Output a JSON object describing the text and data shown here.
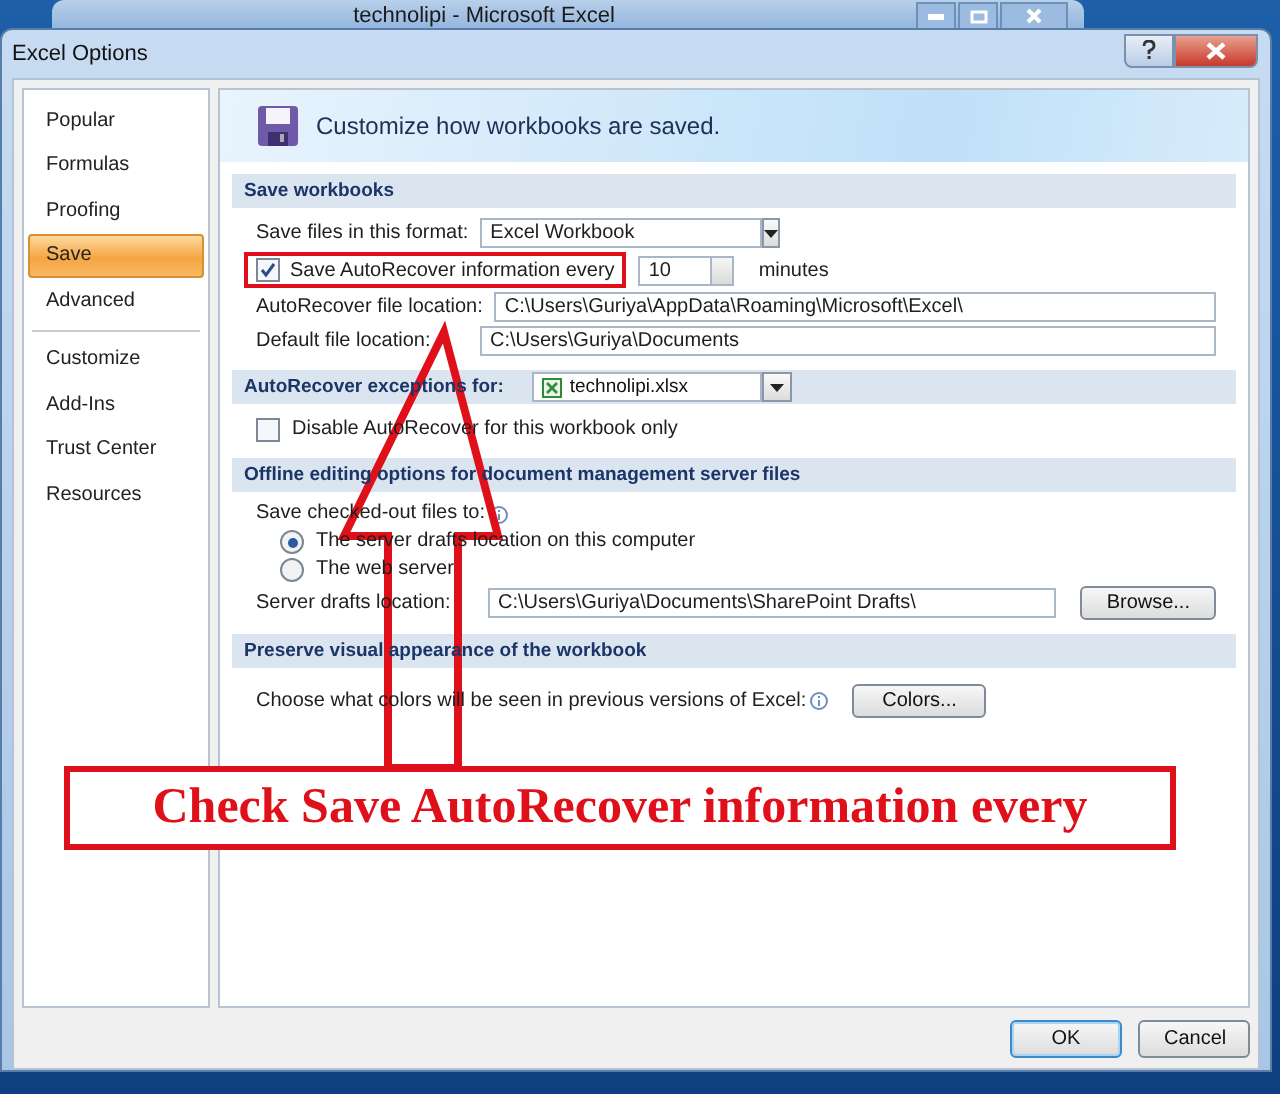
{
  "excel_window": {
    "title": "technolipi - Microsoft Excel"
  },
  "dialog": {
    "title": "Excel Options"
  },
  "sidebar": {
    "groups": [
      [
        {
          "label": "Popular",
          "selected": false
        },
        {
          "label": "Formulas",
          "selected": false
        },
        {
          "label": "Proofing",
          "selected": false
        },
        {
          "label": "Save",
          "selected": true
        },
        {
          "label": "Advanced",
          "selected": false
        }
      ],
      [
        {
          "label": "Customize",
          "selected": false
        },
        {
          "label": "Add-Ins",
          "selected": false
        },
        {
          "label": "Trust Center",
          "selected": false
        },
        {
          "label": "Resources",
          "selected": false
        }
      ]
    ]
  },
  "header": {
    "text": "Customize how workbooks are saved."
  },
  "sections": [
    {
      "title": "Save workbooks",
      "rows": [
        {
          "kind": "dropdown",
          "label": "Save files in this format:",
          "value": "Excel Workbook"
        },
        {
          "kind": "checkbox-spin",
          "label": "Save AutoRecover information every",
          "checked": true,
          "highlighted": true,
          "value": "10",
          "unit": "minutes"
        },
        {
          "kind": "path",
          "label": "AutoRecover file location:",
          "value": "C:\\Users\\Guriya\\AppData\\Roaming\\Microsoft\\Excel\\"
        },
        {
          "kind": "path",
          "label": "Default file location:",
          "value": "C:\\Users\\Guriya\\Documents"
        }
      ]
    },
    {
      "title": "AutoRecover exceptions for:",
      "workbook": "technolipi.xlsx",
      "rows": [
        {
          "kind": "checkbox",
          "label": "Disable AutoRecover for this workbook only",
          "checked": false
        }
      ]
    },
    {
      "title": "Offline editing options for document management server files",
      "rows": [
        {
          "kind": "info-text",
          "label": "Save checked-out files to:"
        },
        {
          "kind": "radio",
          "label": "The server drafts location on this computer",
          "selected": true
        },
        {
          "kind": "radio",
          "label": "The web server",
          "selected": false
        },
        {
          "kind": "path-browse",
          "label": "Server drafts location:",
          "value": "C:\\Users\\Guriya\\Documents\\SharePoint Drafts\\",
          "button": "Browse..."
        }
      ]
    },
    {
      "title": "Preserve visual appearance of the workbook",
      "rows": [
        {
          "kind": "info-button",
          "label": "Choose what colors will be seen in previous versions of Excel:",
          "button": "Colors..."
        }
      ]
    }
  ],
  "buttons": [
    {
      "label": "OK",
      "default": true
    },
    {
      "label": "Cancel",
      "default": false
    }
  ],
  "annotation": {
    "callout": "Check Save AutoRecover information every"
  }
}
